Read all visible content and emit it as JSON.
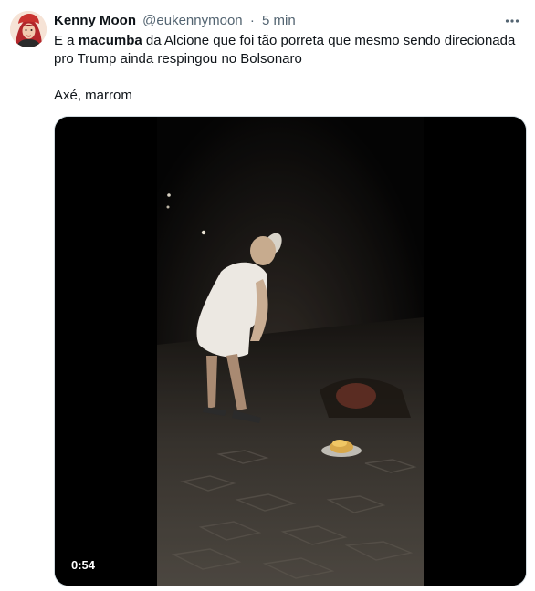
{
  "author": {
    "display_name": "Kenny Moon",
    "handle": "@eukennymoon",
    "separator": "·",
    "time": "5 min"
  },
  "tweet": {
    "line1_before": "E a ",
    "line1_bold": "macumba",
    "line1_after": " da Alcione que foi tão porreta que mesmo sendo direcionada pro Trump  ainda respingou no Bolsonaro",
    "line2": "Axé, marrom"
  },
  "video": {
    "duration": "0:54"
  },
  "icons": {
    "more": "more-dots-icon",
    "avatar": "profile-avatar"
  },
  "colors": {
    "text": "#0f1419",
    "secondary": "#536471",
    "border": "#cfd9de"
  }
}
